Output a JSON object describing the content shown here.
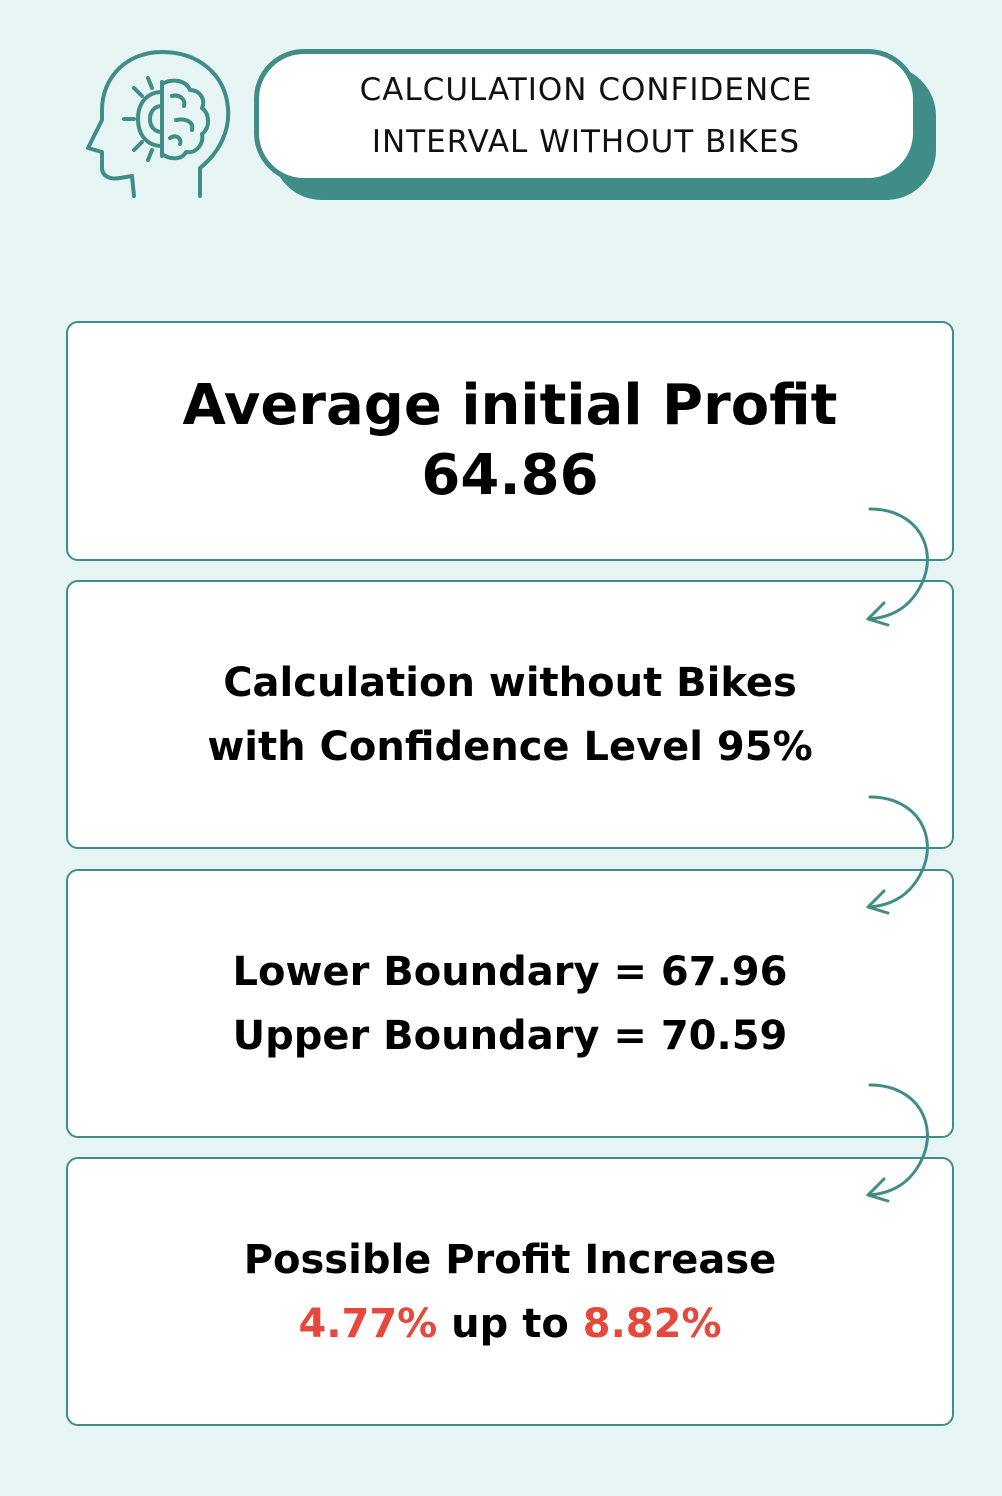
{
  "header": {
    "title_line1": "CALCULATION CONFIDENCE",
    "title_line2": "INTERVAL WITHOUT BIKES",
    "icon": "head-gear-brain-icon"
  },
  "steps": [
    {
      "line1": "Average initial Profit",
      "line2": "64.86"
    },
    {
      "line1": "Calculation without Bikes",
      "line2": "with Confidence Level 95%"
    },
    {
      "line1": "Lower Boundary = 67.96",
      "line2": "Upper Boundary = 70.59"
    },
    {
      "line1": "Possible Profit Increase",
      "low": "4.77%",
      "connector": " up to ",
      "high": "8.82%"
    }
  ],
  "colors": {
    "background": "#e6f4f4",
    "accent": "#3f8d86",
    "highlight": "#e5493c"
  },
  "arrow_icon": "curved-arrow-down-icon"
}
